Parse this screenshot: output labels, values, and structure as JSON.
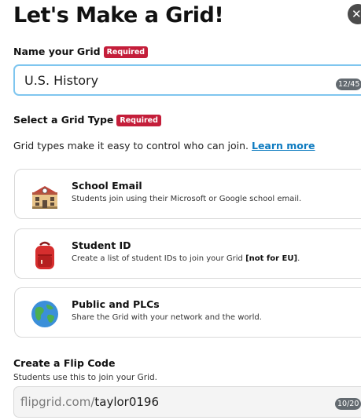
{
  "dialog": {
    "title": "Let's Make a Grid!",
    "close_symbol": "✕"
  },
  "name_grid": {
    "label": "Name your Grid",
    "required": "Required",
    "value": "U.S. History",
    "counter": "12/45"
  },
  "grid_type": {
    "label": "Select a Grid Type",
    "required": "Required",
    "description": "Grid types make it easy to control who can join.",
    "learn_more": "Learn more",
    "options": [
      {
        "icon": "school-building-icon",
        "title": "School Email",
        "text": "Students join using their Microsoft or Google school email."
      },
      {
        "icon": "red-backpack-icon",
        "title": "Student ID",
        "text": "Create a list of student IDs to join your Grid",
        "emphasis": "[not for EU]",
        "suffix": "."
      },
      {
        "icon": "globe-icon",
        "title": "Public and PLCs",
        "text": "Share the Grid with your network and the world."
      }
    ]
  },
  "flip_code": {
    "label": "Create a Flip Code",
    "subtext": "Students use this to join your Grid.",
    "prefix": "flipgrid.com/",
    "value": "taylor0196",
    "counter": "10/20"
  },
  "colors": {
    "required_badge": "#c41e3a",
    "link": "#0e7bc0",
    "active_input_border": "#7fc6ef",
    "counter_badge": "#636a70"
  }
}
